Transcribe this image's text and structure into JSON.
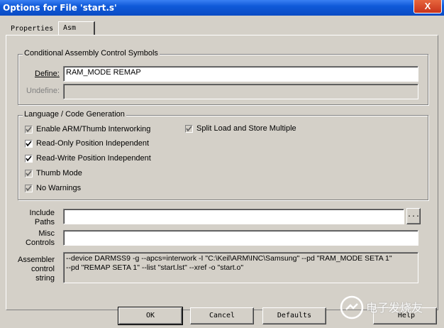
{
  "window": {
    "title": "Options for File 'start.s'",
    "close_label": "X"
  },
  "tabs": [
    {
      "label": "Properties"
    },
    {
      "label": "Asm"
    }
  ],
  "conditional": {
    "legend": "Conditional Assembly Control Symbols",
    "define_label": "Define:",
    "define_value": "RAM_MODE REMAP",
    "undefine_label": "Undefine:",
    "undefine_value": ""
  },
  "language": {
    "legend": "Language / Code Generation",
    "options": [
      {
        "label": "Enable ARM/Thumb Interworking",
        "checked": true,
        "enabled": true
      },
      {
        "label": "Read-Only Position Independent",
        "checked": true,
        "enabled": true
      },
      {
        "label": "Read-Write Position Independent",
        "checked": true,
        "enabled": true
      },
      {
        "label": "Thumb Mode",
        "checked": true,
        "enabled": true
      },
      {
        "label": "No Warnings",
        "checked": true,
        "enabled": true
      },
      {
        "label": "Split Load and Store Multiple",
        "checked": true,
        "enabled": true
      }
    ]
  },
  "include_paths": {
    "label_line1": "Include",
    "label_line2": "Paths",
    "value": "",
    "browse_label": "..."
  },
  "misc_controls": {
    "label_line1": "Misc",
    "label_line2": "Controls",
    "value": ""
  },
  "assembler_control": {
    "label_line1": "Assembler",
    "label_line2": "control",
    "label_line3": "string",
    "line1": "--device DARMSS9 -g --apcs=interwork -I \"C:\\Keil\\ARM\\INC\\Samsung\" --pd \"RAM_MODE SETA 1\"",
    "line2": "--pd \"REMAP SETA 1\" --list \"start.lst\" --xref -o \"start.o\""
  },
  "buttons": {
    "ok": "OK",
    "cancel": "Cancel",
    "defaults": "Defaults",
    "help": "Help"
  },
  "watermark": {
    "text": "电子发烧友"
  }
}
